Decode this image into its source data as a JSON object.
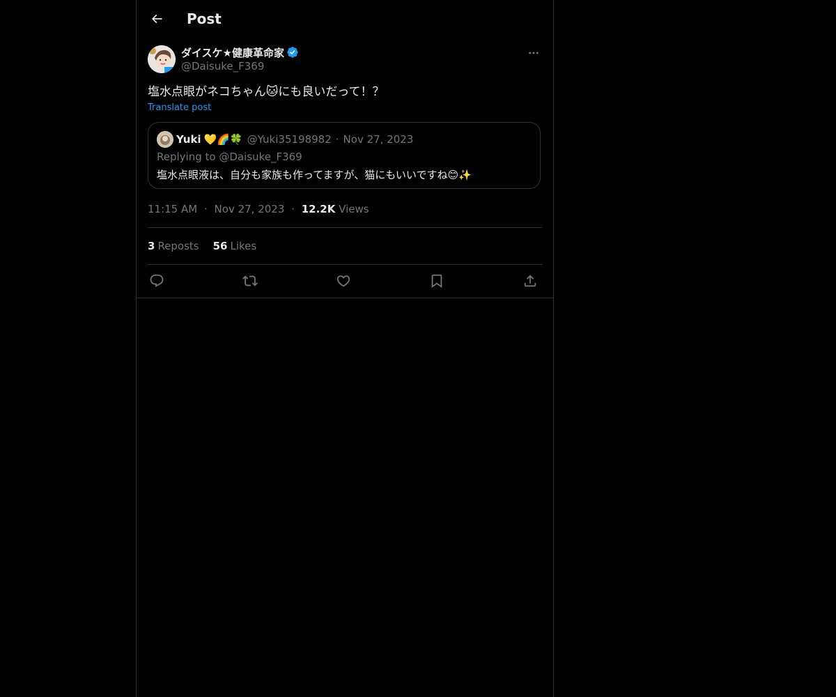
{
  "header": {
    "title": "Post"
  },
  "post": {
    "author_name": "ダイスケ★健康革命家",
    "author_handle": "@Daisuke_F369",
    "text": "塩水点眼がネコちゃん🐱にも良いだって！？",
    "translate_label": "Translate post",
    "time": "11:15 AM",
    "date": "Nov 27, 2023",
    "views_count": "12.2K",
    "views_label": "Views",
    "reposts_count": "3",
    "reposts_label": "Reposts",
    "likes_count": "56",
    "likes_label": "Likes"
  },
  "quote": {
    "name": "Yuki",
    "name_emoji": "💛🌈🍀",
    "handle": "@Yuki35198982",
    "date": "Nov 27, 2023",
    "replying_to": "Replying to @Daisuke_F369",
    "text": "塩水点眼液は、自分も家族も作ってますが、猫にもいいですね😊✨"
  },
  "separator": "·",
  "icons": {
    "back": "arrow-left-icon",
    "more": "more-horizontal-icon",
    "verified": "verified-badge-icon",
    "reply": "reply-icon",
    "repost": "repost-icon",
    "like": "heart-icon",
    "bookmark": "bookmark-icon",
    "share": "share-icon"
  },
  "colors": {
    "background": "#000000",
    "text": "#e7e9ea",
    "secondary": "#71767b",
    "accent": "#1d9bf0",
    "border": "#2f3336"
  }
}
